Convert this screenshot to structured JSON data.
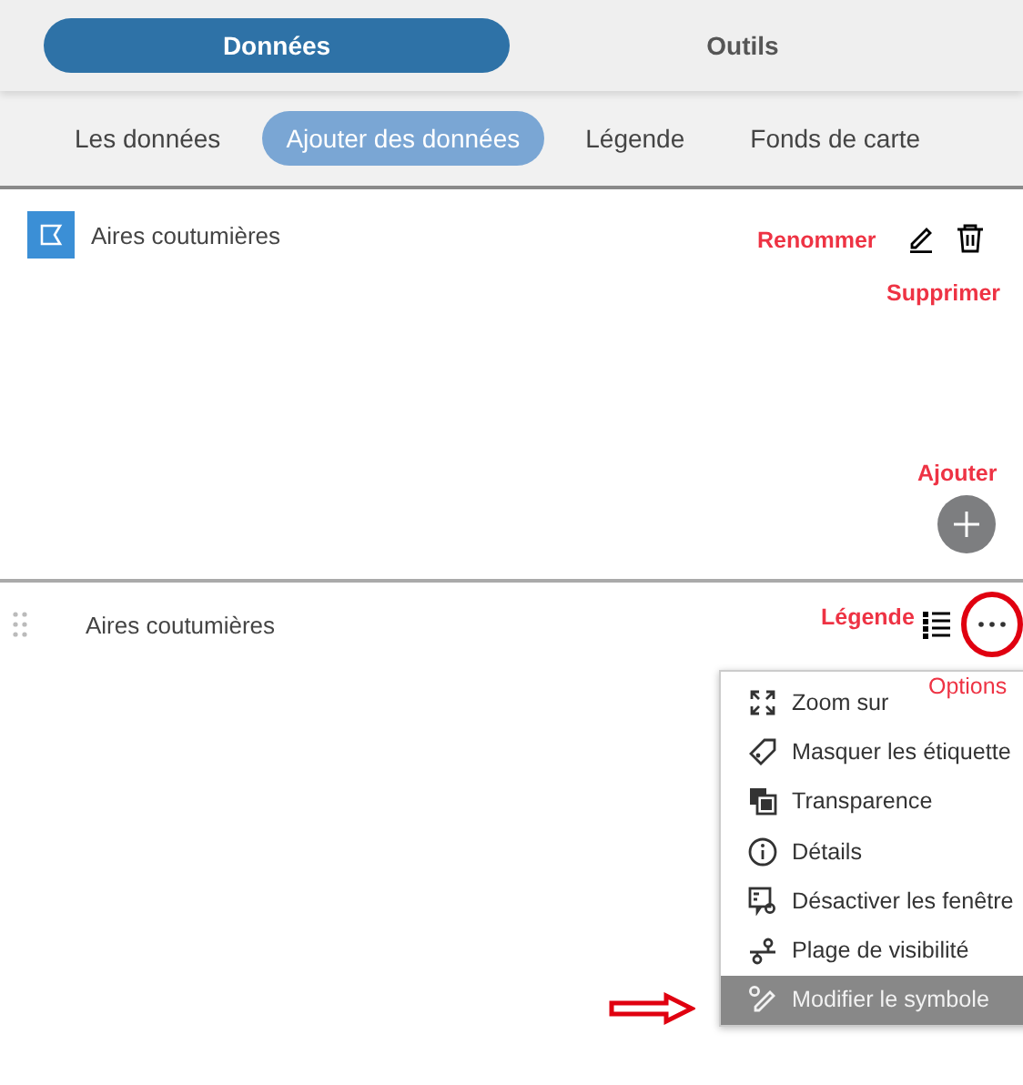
{
  "main_tabs": [
    {
      "label": "Données",
      "selected": true
    },
    {
      "label": "Outils",
      "selected": false
    }
  ],
  "sub_tabs": [
    {
      "label": "Les données",
      "selected": false
    },
    {
      "label": "Ajouter des données",
      "selected": true
    },
    {
      "label": "Légende",
      "selected": false
    },
    {
      "label": "Fonds de carte",
      "selected": false
    }
  ],
  "added_layer": {
    "name": "Aires coutumières"
  },
  "layer": {
    "name": "Aires coutumières"
  },
  "menu": [
    {
      "label": "Zoom sur",
      "selected": false
    },
    {
      "label": "Masquer les étiquette",
      "selected": false
    },
    {
      "label": "Transparence",
      "selected": false
    },
    {
      "label": "Détails",
      "selected": false
    },
    {
      "label": "Désactiver les fenêtre",
      "selected": false
    },
    {
      "label": "Plage de visibilité",
      "selected": false
    },
    {
      "label": "Modifier le symbole",
      "selected": true
    }
  ],
  "annotations": {
    "rename": "Renommer",
    "delete": "Supprimer",
    "add": "Ajouter",
    "legend": "Légende",
    "options": "Options"
  }
}
